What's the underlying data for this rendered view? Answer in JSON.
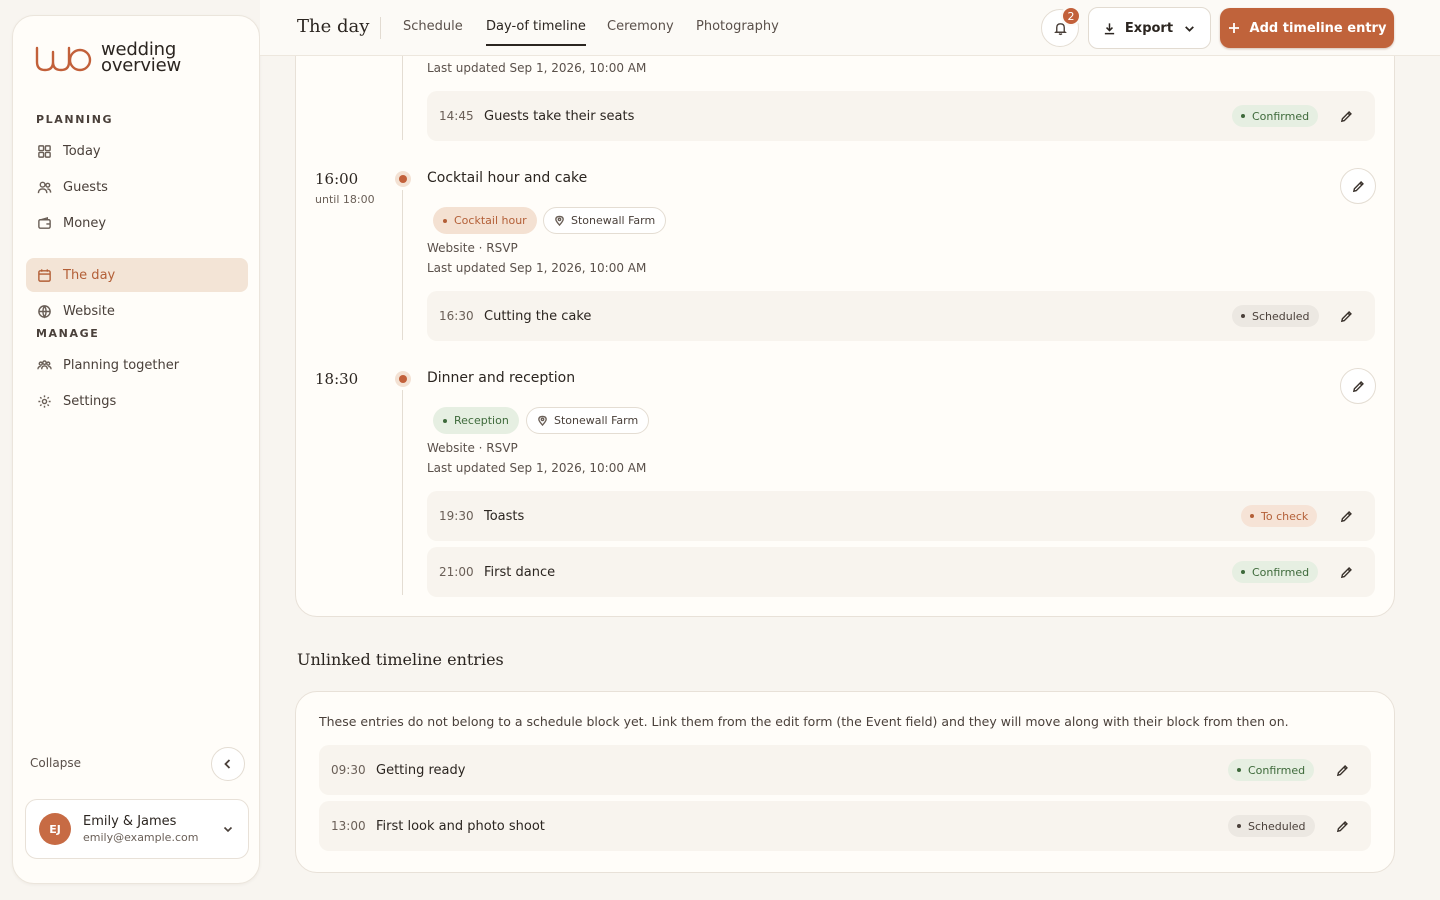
{
  "brand": {
    "line1": "wedding",
    "line2": "overview",
    "accent": "#c2603a"
  },
  "sidebar": {
    "planning_title": "PLANNING",
    "manage_title": "MANAGE",
    "planning_items": [
      {
        "label": "Today",
        "icon": "grid-icon"
      },
      {
        "label": "Guests",
        "icon": "users-icon"
      },
      {
        "label": "Money",
        "icon": "wallet-icon"
      },
      {
        "label": "The day",
        "icon": "calendar-icon",
        "active": true
      },
      {
        "label": "Website",
        "icon": "globe-icon"
      }
    ],
    "manage_items": [
      {
        "label": "Planning together",
        "icon": "team-icon"
      },
      {
        "label": "Settings",
        "icon": "gear-icon"
      }
    ],
    "collapse_label": "Collapse",
    "user": {
      "initials": "EJ",
      "name": "Emily & James",
      "email": "emily@example.com"
    }
  },
  "header": {
    "title": "The day",
    "tabs": [
      "Schedule",
      "Day-of timeline",
      "Ceremony",
      "Photography"
    ],
    "active_tab": "Day-of timeline",
    "notification_count": "2",
    "export_label": "Export",
    "add_label": "Add timeline entry"
  },
  "timeline": {
    "top_meta": "Last updated Sep 1, 2026, 10:00 AM",
    "top_row": {
      "time": "14:45",
      "title": "Guests take their seats",
      "status": "Confirmed"
    },
    "blocks": [
      {
        "time": "16:00",
        "until": "until 18:00",
        "title": "Cocktail hour and cake",
        "category": "Cocktail hour",
        "location": "Stonewall Farm",
        "source": "Website · RSVP",
        "updated": "Last updated Sep 1, 2026, 10:00 AM",
        "entries": [
          {
            "time": "16:30",
            "title": "Cutting the cake",
            "status": "Scheduled"
          }
        ]
      },
      {
        "time": "18:30",
        "title": "Dinner and reception",
        "category": "Reception",
        "location": "Stonewall Farm",
        "source": "Website · RSVP",
        "updated": "Last updated Sep 1, 2026, 10:00 AM",
        "entries": [
          {
            "time": "19:30",
            "title": "Toasts",
            "status": "To check"
          },
          {
            "time": "21:00",
            "title": "First dance",
            "status": "Confirmed"
          }
        ]
      }
    ]
  },
  "unlinked": {
    "title": "Unlinked timeline entries",
    "description": "These entries do not belong to a schedule block yet. Link them from the edit form (the Event field) and they will move along with their block from then on.",
    "entries": [
      {
        "time": "09:30",
        "title": "Getting ready",
        "status": "Confirmed"
      },
      {
        "time": "13:00",
        "title": "First look and photo shoot",
        "status": "Scheduled"
      }
    ]
  }
}
